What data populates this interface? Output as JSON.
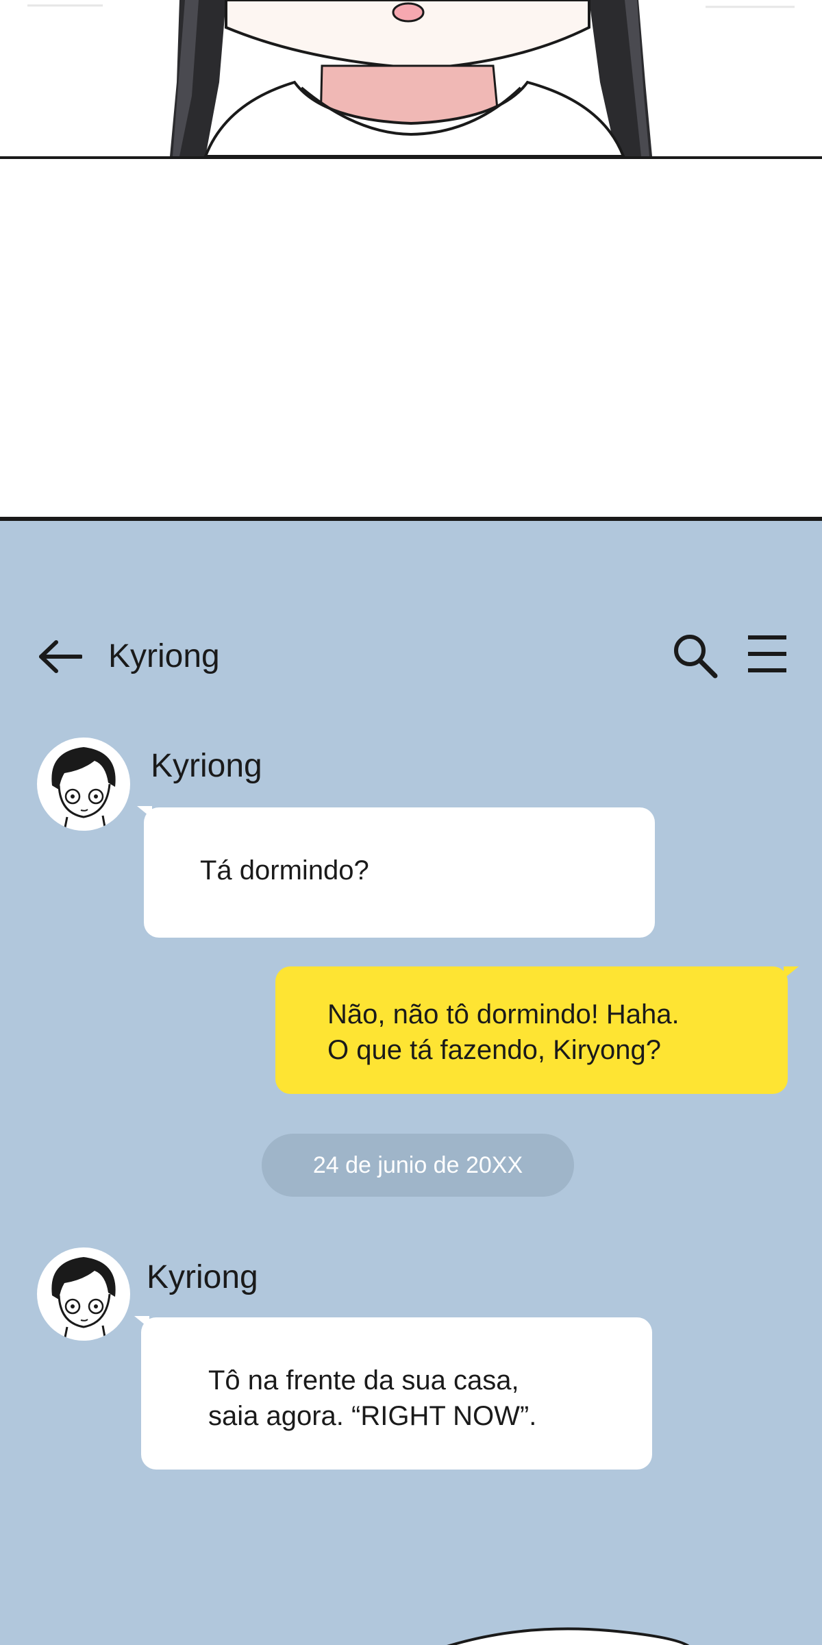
{
  "chat": {
    "contact_name": "Kyriong",
    "icons": {
      "back": "arrow-left-icon",
      "search": "search-icon",
      "menu": "menu-icon"
    },
    "messages": [
      {
        "sender": "Kyriong",
        "direction": "incoming",
        "lines": [
          "Tá dormindo?"
        ]
      },
      {
        "direction": "outgoing",
        "lines": [
          "Não, não tô dormindo! Haha.",
          "O que tá fazendo, Kiryong?"
        ]
      },
      {
        "sender": "Kyriong",
        "direction": "incoming",
        "lines": [
          "Tô na frente da sua casa,",
          "saia agora. “RIGHT NOW”."
        ]
      }
    ],
    "date_divider": "24 de junio de 20XX"
  },
  "colors": {
    "chat_background": "#b1c7dc",
    "outgoing_bubble": "#fee433",
    "incoming_bubble": "#ffffff",
    "date_pill": "#9fb5c9"
  }
}
